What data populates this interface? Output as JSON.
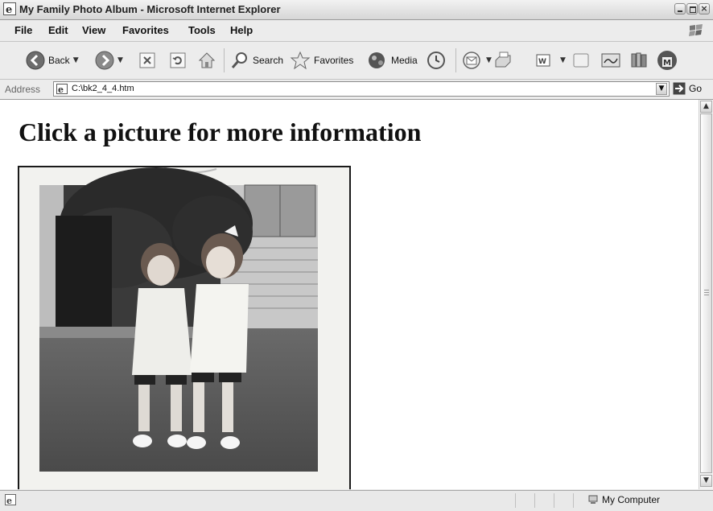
{
  "window": {
    "title": "My Family Photo Album - Microsoft Internet Explorer",
    "controls": [
      "minimize-icon",
      "restore-icon",
      "close-icon"
    ]
  },
  "menubar": {
    "items": [
      "File",
      "Edit",
      "View",
      "Favorites",
      "Tools",
      "Help"
    ]
  },
  "toolbar": {
    "back_label": "Back",
    "search_label": "Search",
    "favorites_label": "Favorites",
    "media_label": "Media",
    "icons": [
      "back-icon",
      "forward-icon",
      "stop-icon",
      "refresh-icon",
      "home-icon",
      "search-icon",
      "favorites-star-icon",
      "media-icon",
      "history-icon",
      "mail-icon",
      "print-icon",
      "edit-icon",
      "discuss-icon",
      "messenger-icon",
      "research-icon",
      "msn-icon"
    ]
  },
  "addressbar": {
    "label": "Address",
    "url": "C:\\bk2_4_4.htm",
    "go_label": "Go"
  },
  "page": {
    "heading": "Click a picture for more information",
    "photo_description_icon": "family-photo"
  },
  "statusbar": {
    "zone_label": "My Computer"
  },
  "colors": {
    "chrome": "#e6e6e6",
    "content_bg": "#ffffff",
    "heading": "#111111"
  }
}
